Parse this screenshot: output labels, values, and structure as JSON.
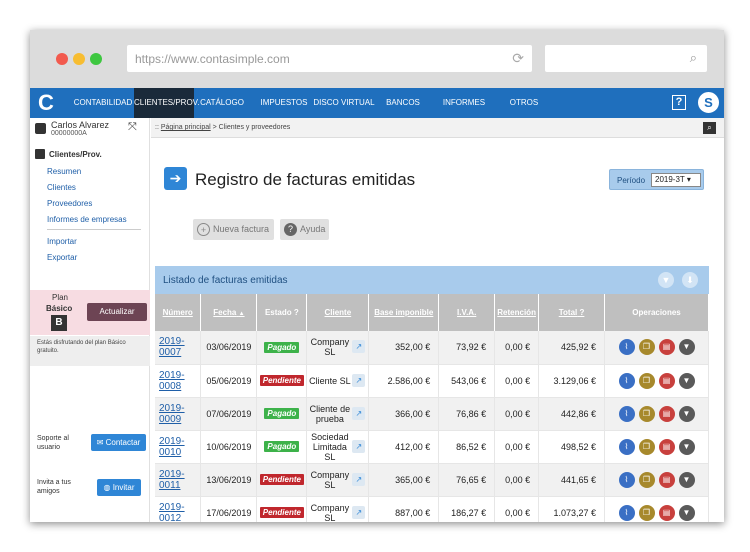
{
  "browser": {
    "url": "https://www.contasimple.com"
  },
  "nav": {
    "logo": "C",
    "items": [
      "CONTABILIDAD",
      "CLIENTES/PROV.",
      "CATÁLOGO",
      "IMPUESTOS",
      "DISCO VIRTUAL",
      "BANCOS",
      "INFORMES",
      "OTROS"
    ],
    "help": "?",
    "user_initial": "S"
  },
  "sidebar": {
    "user_name": "Carlos Alvarez",
    "user_nif": "00000000A",
    "section_title": "Clientes/Prov.",
    "links": [
      "Resumen",
      "Clientes",
      "Proveedores",
      "Informes de empresas"
    ],
    "links2": [
      "Importar",
      "Exportar"
    ],
    "plan_label": "Plan",
    "plan_name": "Básico",
    "plan_letter": "B",
    "upgrade_label": "Actualizar",
    "plan_note": "Estás disfrutando del plan Básico gratuito.",
    "support_label": "Soporte al usuario",
    "contact_label": "Contactar",
    "invite_label": "Invita a tus amigos",
    "invite_button": "Invitar"
  },
  "breadcrumb": {
    "prefix": "::",
    "home": "Página principal",
    "current": "Clientes y proveedores"
  },
  "page": {
    "title": "Registro de facturas emitidas",
    "period_label": "Período",
    "period_value": "2019-3T",
    "new_invoice": "Nueva factura",
    "help": "Ayuda",
    "list_title": "Listado de facturas emitidas"
  },
  "table": {
    "headers": [
      "Número",
      "Fecha",
      "Estado",
      "Cliente",
      "Base imponible",
      "I.V.A.",
      "Retención",
      "Total",
      "Operaciones"
    ],
    "sort_arrow": "▲",
    "rows": [
      {
        "num": "2019-0007",
        "date": "03/06/2019",
        "status": "Pagado",
        "client": "Company SL",
        "base": "352,00 €",
        "iva": "73,92 €",
        "ret": "0,00 €",
        "total": "425,92 €"
      },
      {
        "num": "2019-0008",
        "date": "05/06/2019",
        "status": "Pendiente",
        "client": "Cliente SL",
        "base": "2.586,00 €",
        "iva": "543,06 €",
        "ret": "0,00 €",
        "total": "3.129,06 €"
      },
      {
        "num": "2019-0009",
        "date": "07/06/2019",
        "status": "Pagado",
        "client": "Cliente de prueba",
        "base": "366,00 €",
        "iva": "76,86 €",
        "ret": "0,00 €",
        "total": "442,86 €"
      },
      {
        "num": "2019-0010",
        "date": "10/06/2019",
        "status": "Pagado",
        "client": "Sociedad Limitada SL",
        "base": "412,00 €",
        "iva": "86,52 €",
        "ret": "0,00 €",
        "total": "498,52 €"
      },
      {
        "num": "2019-0011",
        "date": "13/06/2019",
        "status": "Pendiente",
        "client": "Company SL",
        "base": "365,00 €",
        "iva": "76,65 €",
        "ret": "0,00 €",
        "total": "441,65 €"
      },
      {
        "num": "2019-0012",
        "date": "17/06/2019",
        "status": "Pendiente",
        "client": "Company SL",
        "base": "887,00 €",
        "iva": "186,27 €",
        "ret": "0,00 €",
        "total": "1.073,27 €"
      }
    ]
  },
  "colors": {
    "nav": "#1f6fbd",
    "paid": "#3db24a",
    "pending": "#c0272d",
    "header_bar": "#a8cbec"
  }
}
